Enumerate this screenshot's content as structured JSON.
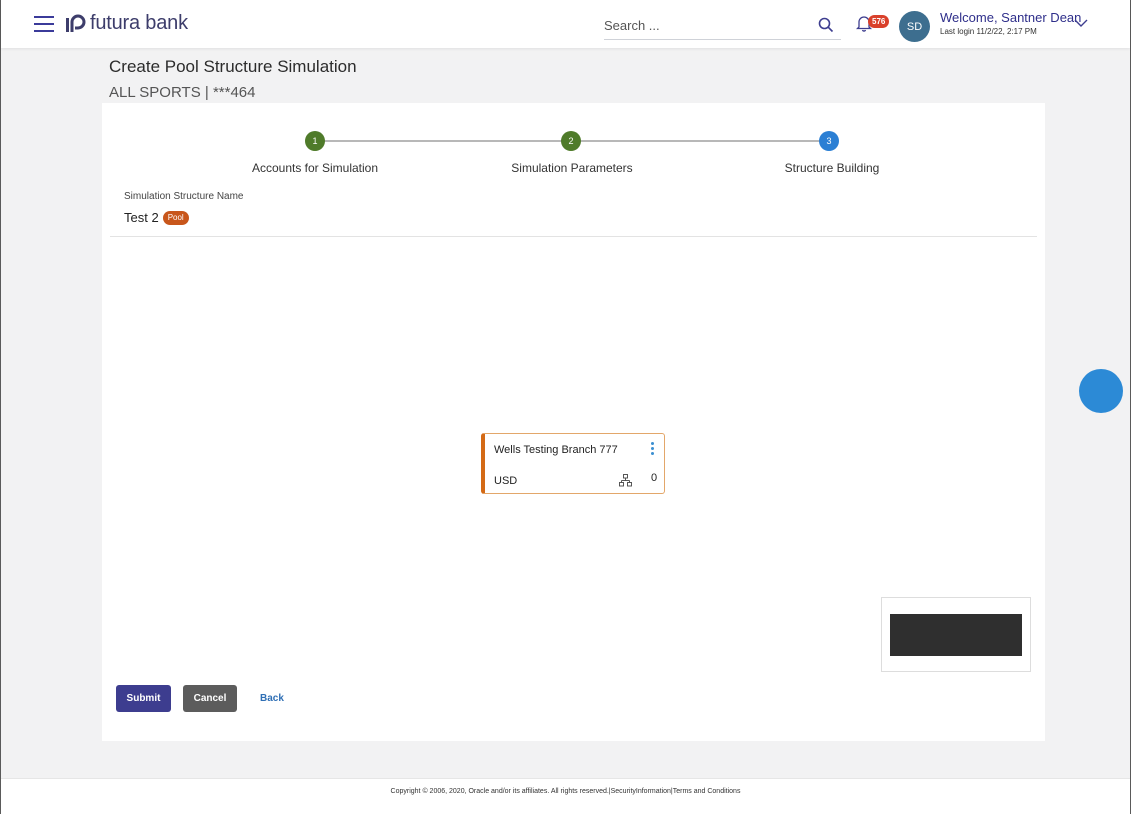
{
  "header": {
    "brand": "futura bank",
    "search_placeholder": "Search ...",
    "notification_count": "576",
    "avatar_initials": "SD",
    "welcome_text": "Welcome, Santner Dean",
    "last_login": "Last login 11/2/22, 2:17 PM"
  },
  "page": {
    "title": "Create Pool Structure Simulation",
    "subtitle": "ALL SPORTS | ***464"
  },
  "stepper": {
    "steps": [
      {
        "number": "1",
        "label": "Accounts for Simulation",
        "status": "completed",
        "color": "#4f7b2a"
      },
      {
        "number": "2",
        "label": "Simulation Parameters",
        "status": "completed",
        "color": "#4f7b2a"
      },
      {
        "number": "3",
        "label": "Structure Building",
        "status": "active",
        "color": "#2b7fd4"
      }
    ]
  },
  "simulation": {
    "name_label": "Simulation Structure Name",
    "name_value": "Test 2",
    "type_badge": "Pool"
  },
  "node": {
    "name": "Wells Testing Branch 777",
    "currency": "USD",
    "child_count": "0",
    "accent_color": "#d46a16"
  },
  "actions": {
    "submit_label": "Submit",
    "cancel_label": "Cancel",
    "back_label": "Back"
  },
  "footer": {
    "copyright": "Copyright © 2006, 2020, Oracle and/or its affiliates. All rights reserved.|SecurityInformation|Terms and Conditions"
  }
}
